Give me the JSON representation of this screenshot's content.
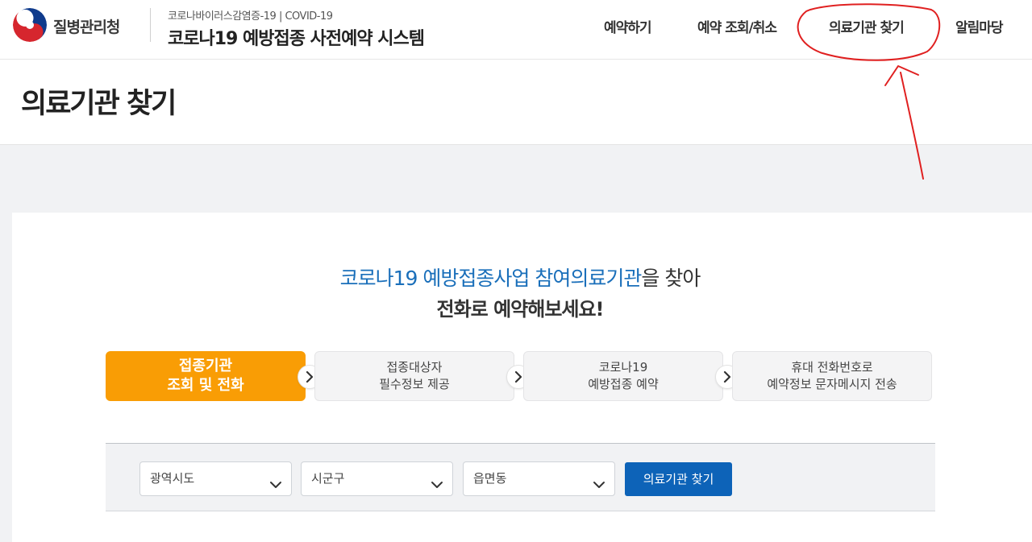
{
  "header": {
    "agency_name": "질병관리청",
    "subtitle": "코로나바이러스감염증-19 | COVID-19",
    "system_title": "코로나19 예방접종 사전예약 시스템",
    "nav": [
      {
        "label": "예약하기"
      },
      {
        "label": "예약 조회/취소"
      },
      {
        "label": "의료기관 찾기"
      },
      {
        "label": "알림마당"
      }
    ]
  },
  "page": {
    "title": "의료기관 찾기"
  },
  "intro": {
    "line1_part1": "코로나19 예방접종사업 ",
    "line1_part2": "참여의료기관",
    "line1_part3": "을 찾아",
    "line2": "전화로 예약해보세요!"
  },
  "steps": [
    {
      "line1": "접종기관",
      "line2": "조회 및 전화",
      "active": true
    },
    {
      "line1": "접종대상자",
      "line2": "필수정보 제공",
      "active": false
    },
    {
      "line1": "코로나19",
      "line2": "예방접종 예약",
      "active": false
    },
    {
      "line1": "휴대 전화번호로",
      "line2": "예약정보 문자메시지 전송",
      "active": false
    }
  ],
  "search": {
    "province": "광역시도",
    "district": "시군구",
    "town": "읍면동",
    "button": "의료기관 찾기"
  },
  "icons": {
    "logo": "korea-taegeuk-logo-icon",
    "step_arrow": "chevron-right-icon",
    "select_arrow": "chevron-down-icon"
  },
  "colors": {
    "accent_orange": "#f99d05",
    "primary_blue": "#0d63b8",
    "highlight_blue": "#1a6fba",
    "annotation_red": "#e02020"
  }
}
